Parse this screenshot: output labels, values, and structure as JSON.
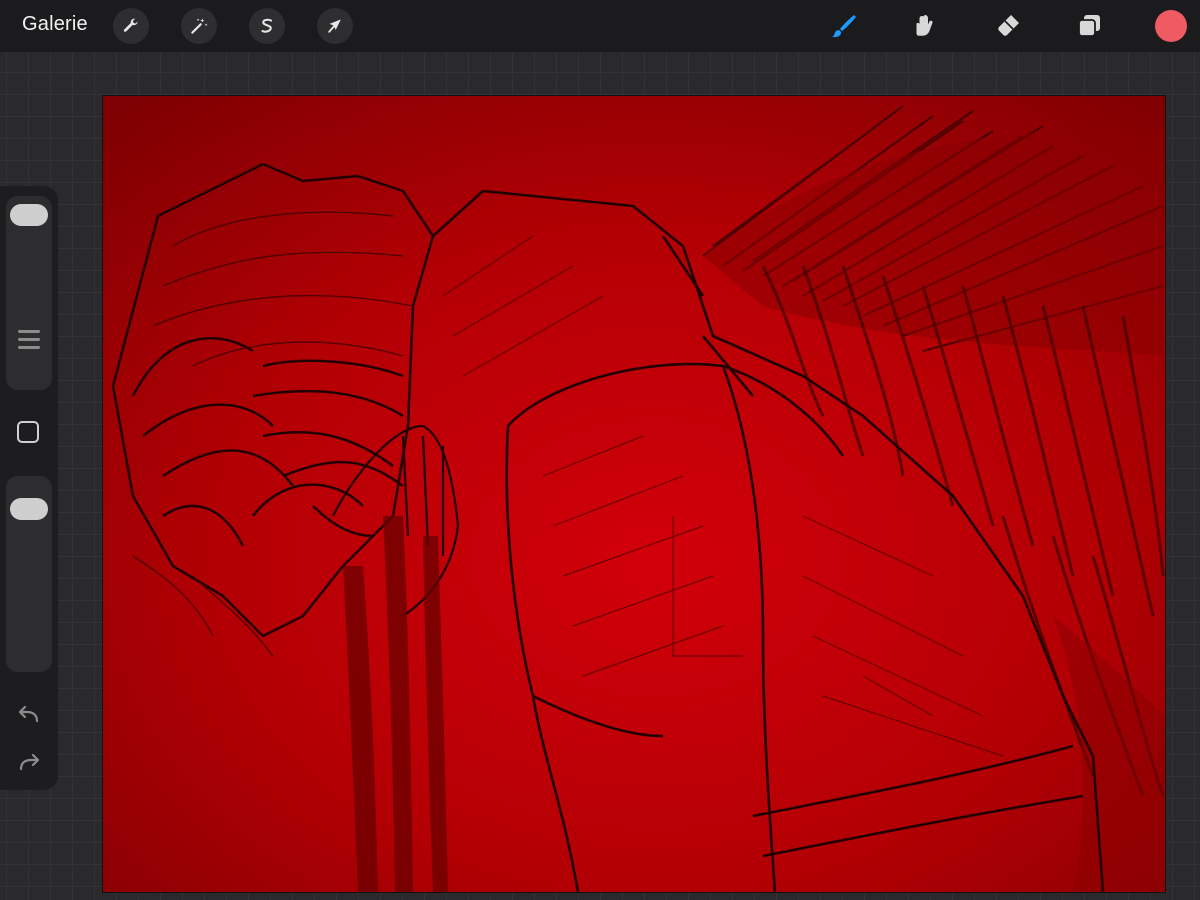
{
  "header": {
    "gallery_label": "Galerie",
    "left_tools": [
      {
        "icon": "wrench-icon",
        "name": "actions"
      },
      {
        "icon": "magic-wand-icon",
        "name": "adjustments"
      },
      {
        "icon": "selection-s-icon",
        "name": "selection"
      },
      {
        "icon": "arrow-cursor-icon",
        "name": "transform"
      }
    ],
    "right_tools": [
      {
        "icon": "brush-icon",
        "name": "paint",
        "active": true
      },
      {
        "icon": "smudge-icon",
        "name": "smudge"
      },
      {
        "icon": "eraser-icon",
        "name": "eraser"
      },
      {
        "icon": "layers-icon",
        "name": "layers"
      }
    ],
    "current_color": "#ef5a63"
  },
  "sidebar": {
    "brush_size_slider": {
      "value_fraction": 1.0
    },
    "opacity_slider": {
      "value_fraction": 1.0
    },
    "icons": [
      "slider-grip-icon",
      "modify-square-icon",
      "undo-icon",
      "redo-icon"
    ]
  },
  "canvas": {
    "colors": {
      "background_light": "#d00008",
      "background_dark": "#7f0002",
      "lineart": "#2a0000",
      "accent": "#1a9bff"
    }
  }
}
